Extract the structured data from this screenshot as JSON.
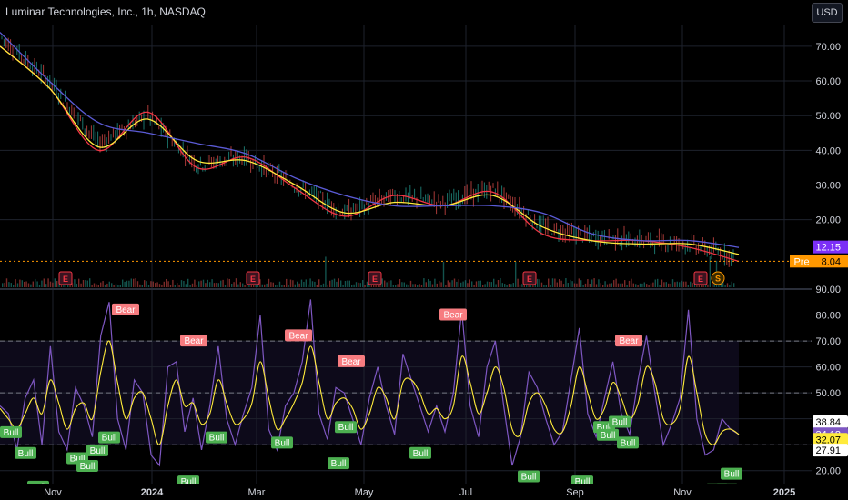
{
  "header": {
    "title": "Luminar Technologies, Inc., 1h, NASDAQ",
    "currency_button": "USD"
  },
  "price_axis": {
    "ticks": [
      "70.00",
      "60.00",
      "50.00",
      "40.00",
      "30.00",
      "20.00"
    ]
  },
  "osc_axis": {
    "ticks": [
      "90.00",
      "80.00",
      "70.00",
      "60.00",
      "50.00",
      "40.00",
      "30.00",
      "20.00"
    ]
  },
  "time_axis": {
    "labels": [
      "Nov",
      "2024",
      "Mar",
      "May",
      "Jul",
      "Sep",
      "Nov",
      "2025"
    ]
  },
  "price_badges": {
    "last": "12.15",
    "pre_label": "Pre",
    "pre_value": "8.04"
  },
  "osc_badges": [
    "38.84",
    "34.18",
    "32.07",
    "27.91"
  ],
  "earnings_markers": [
    "E",
    "E",
    "E",
    "E",
    "E"
  ],
  "split_marker": "S",
  "signal_labels": {
    "bear": "Bear",
    "bull": "Bull"
  },
  "colors": {
    "background": "#000000",
    "grid": "#1e222d",
    "ema_fast": "#f23645",
    "ema_mid": "#ffeb3b",
    "ema_slow": "#5b5bd6",
    "osc_line": "#7e57c2",
    "signal_line": "#ffeb3b",
    "bear": "#f77c80",
    "bull": "#4caf50",
    "last_badge": "#7b2ff7",
    "pre_badge": "#ff9800",
    "osc_badge_purple": "#7e57c2",
    "osc_badge_yellow": "#ffeb3b"
  },
  "chart_data": [
    {
      "type": "line",
      "title": "Luminar Technologies, Inc., 1h, NASDAQ",
      "y_range": [
        0,
        76
      ],
      "x": [
        "2023-10",
        "2023-11",
        "2023-12",
        "2024-01",
        "2024-02",
        "2024-03",
        "2024-04",
        "2024-05",
        "2024-06",
        "2024-07",
        "2024-08",
        "2024-09",
        "2024-10",
        "2024-11",
        "2024-12"
      ],
      "price": [
        73,
        60,
        42,
        50,
        36,
        38,
        30,
        22,
        27,
        25,
        29,
        18,
        15,
        14,
        13,
        9
      ],
      "series": [
        {
          "values": [
            70,
            58,
            40,
            51,
            35,
            38,
            29,
            21,
            27,
            24,
            28,
            16,
            14,
            14,
            12,
            8
          ]
        },
        {
          "values": [
            70,
            58,
            41,
            49,
            37,
            37,
            30,
            22,
            25,
            24,
            27,
            18,
            14,
            13,
            13,
            10
          ]
        },
        {
          "values": [
            74,
            60,
            48,
            45,
            42,
            39,
            32,
            27,
            24,
            24,
            24,
            22,
            16,
            14,
            14,
            12
          ]
        }
      ],
      "last": 12.15,
      "premarket": 8.04
    },
    {
      "type": "line",
      "y_range": [
        15,
        90
      ],
      "overbought": 70,
      "midline": 50,
      "oversold": 30,
      "values": [
        45,
        42,
        28,
        48,
        55,
        30,
        68,
        35,
        28,
        52,
        45,
        33,
        72,
        85,
        40,
        28,
        55,
        50,
        26,
        22,
        60,
        62,
        35,
        48,
        28,
        45,
        68,
        40,
        30,
        42,
        52,
        80,
        36,
        28,
        45,
        50,
        62,
        86,
        42,
        32,
        52,
        50,
        40,
        30,
        48,
        60,
        45,
        34,
        65,
        55,
        45,
        35,
        45,
        35,
        50,
        82,
        45,
        33,
        60,
        70,
        45,
        22,
        33,
        58,
        52,
        40,
        30,
        35,
        55,
        75,
        42,
        33,
        48,
        62,
        42,
        34,
        55,
        72,
        50,
        30,
        38,
        48,
        82,
        40,
        26,
        28,
        40,
        36,
        34
      ],
      "signal": [
        44,
        40,
        36,
        42,
        48,
        42,
        55,
        46,
        36,
        44,
        46,
        40,
        58,
        70,
        54,
        40,
        48,
        50,
        40,
        30,
        45,
        55,
        45,
        46,
        38,
        42,
        55,
        46,
        38,
        40,
        46,
        62,
        48,
        36,
        40,
        46,
        54,
        68,
        54,
        40,
        46,
        48,
        44,
        36,
        42,
        52,
        48,
        40,
        54,
        55,
        50,
        42,
        44,
        40,
        45,
        64,
        54,
        42,
        50,
        60,
        52,
        36,
        34,
        46,
        50,
        45,
        36,
        35,
        45,
        60,
        50,
        40,
        44,
        54,
        48,
        40,
        46,
        60,
        54,
        40,
        38,
        44,
        64,
        50,
        34,
        30,
        35,
        36,
        34
      ],
      "last_values": [
        38.84,
        34.18,
        32.07,
        27.91
      ],
      "bear_signals": [
        [
          130,
          82
        ],
        [
          205,
          70
        ],
        [
          320,
          72
        ],
        [
          378,
          62
        ],
        [
          490,
          80
        ],
        [
          683,
          70
        ]
      ],
      "bull_signals": [
        [
          2,
          35
        ],
        [
          18,
          27
        ],
        [
          32,
          14
        ],
        [
          75,
          25
        ],
        [
          86,
          22
        ],
        [
          97,
          28
        ],
        [
          110,
          33
        ],
        [
          197,
          16
        ],
        [
          228,
          33
        ],
        [
          300,
          31
        ],
        [
          362,
          23
        ],
        [
          370,
          37
        ],
        [
          452,
          27
        ],
        [
          571,
          18
        ],
        [
          630,
          16
        ],
        [
          654,
          37
        ],
        [
          658,
          34
        ],
        [
          671,
          39
        ],
        [
          680,
          31
        ],
        [
          778,
          13
        ],
        [
          789,
          13
        ],
        [
          794,
          19
        ]
      ]
    }
  ]
}
